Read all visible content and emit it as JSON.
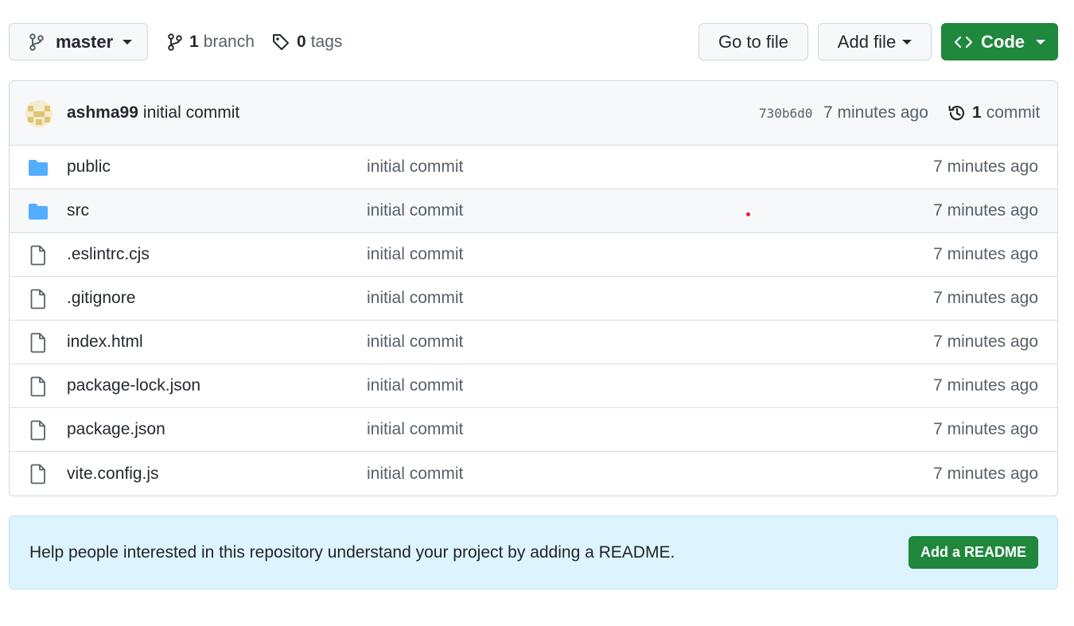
{
  "toolbar": {
    "branch_name": "master",
    "branch_count": "1",
    "branch_label": "branch",
    "tag_count": "0",
    "tag_label": "tags",
    "goto_label": "Go to file",
    "addfile_label": "Add file",
    "code_label": "Code"
  },
  "latest_commit": {
    "author": "ashma99",
    "message": "initial commit",
    "sha": "730b6d0",
    "time": "7 minutes ago",
    "count": "1",
    "count_label": "commit"
  },
  "files": [
    {
      "name": "public",
      "type": "folder",
      "message": "initial commit",
      "time": "7 minutes ago"
    },
    {
      "name": "src",
      "type": "folder",
      "message": "initial commit",
      "time": "7 minutes ago"
    },
    {
      "name": ".eslintrc.cjs",
      "type": "file",
      "message": "initial commit",
      "time": "7 minutes ago"
    },
    {
      "name": ".gitignore",
      "type": "file",
      "message": "initial commit",
      "time": "7 minutes ago"
    },
    {
      "name": "index.html",
      "type": "file",
      "message": "initial commit",
      "time": "7 minutes ago"
    },
    {
      "name": "package-lock.json",
      "type": "file",
      "message": "initial commit",
      "time": "7 minutes ago"
    },
    {
      "name": "package.json",
      "type": "file",
      "message": "initial commit",
      "time": "7 minutes ago"
    },
    {
      "name": "vite.config.js",
      "type": "file",
      "message": "initial commit",
      "time": "7 minutes ago"
    }
  ],
  "readme": {
    "text": "Help people interested in this repository understand your project by adding a README.",
    "button_label": "Add a README"
  },
  "colors": {
    "primary_green": "#1f883d",
    "folder_blue": "#54aeff",
    "banner_bg": "#ddf4ff"
  },
  "icons": {
    "folder": "folder-icon",
    "file": "file-icon"
  }
}
